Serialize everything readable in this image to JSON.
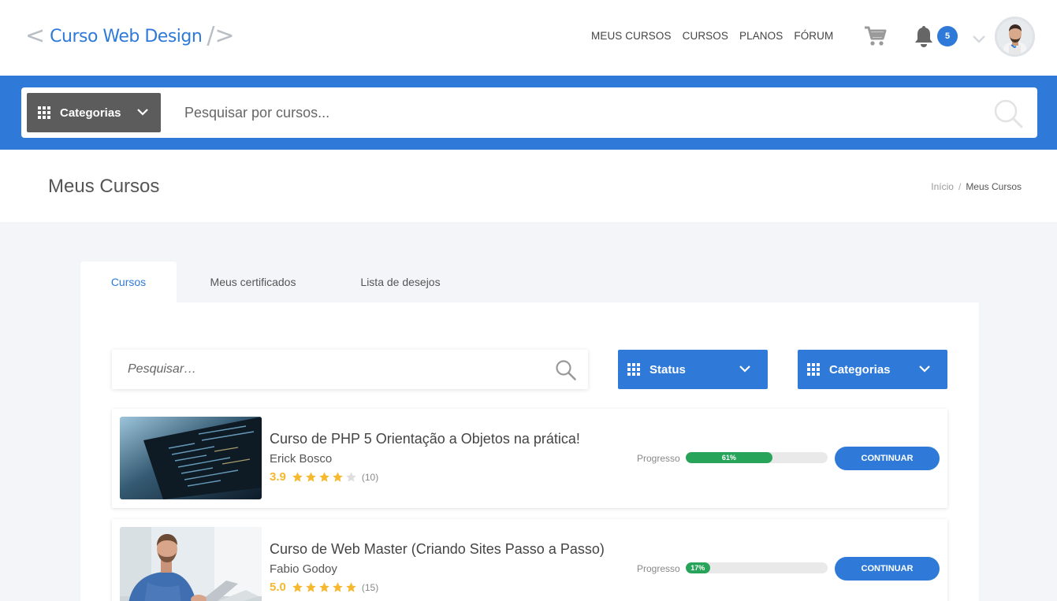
{
  "logo": {
    "text": "Curso Web Design",
    "left_bracket": "<",
    "right_bracket": "/>"
  },
  "nav": [
    "MEUS CURSOS",
    "CURSOS",
    "PLANOS",
    "FÓRUM"
  ],
  "header_icons": {
    "cart": "cart-icon",
    "bell": "bell-icon",
    "notifications_count": "5"
  },
  "search": {
    "categories_label": "Categorias",
    "placeholder": "Pesquisar por cursos..."
  },
  "page": {
    "title": "Meus Cursos",
    "breadcrumb": [
      "Início",
      "Meus Cursos"
    ]
  },
  "tabs": [
    "Cursos",
    "Meus certificados",
    "Lista de desejos"
  ],
  "filters": {
    "search_placeholder": "Pesquisar…",
    "status_label": "Status",
    "categories_label": "Categorias"
  },
  "courses": [
    {
      "title": "Curso de PHP 5 Orientação a Objetos na prática!",
      "author": "Erick Bosco",
      "rating": "3.9",
      "stars": 4,
      "count": "(10)",
      "progress_label": "Progresso",
      "progress": 61,
      "progress_text": "61%",
      "button": "CONTINUAR"
    },
    {
      "title": "Curso de Web Master (Criando Sites Passo a Passo)",
      "author": "Fabio Godoy",
      "rating": "5.0",
      "stars": 5,
      "count": "(15)",
      "progress_label": "Progresso",
      "progress": 17,
      "progress_text": "17%",
      "button": "CONTINUAR"
    }
  ],
  "colors": {
    "primary": "#2f7ad8",
    "dark_button": "#5c5c5c",
    "star": "#f5b82e",
    "progress": "#27a35a"
  }
}
